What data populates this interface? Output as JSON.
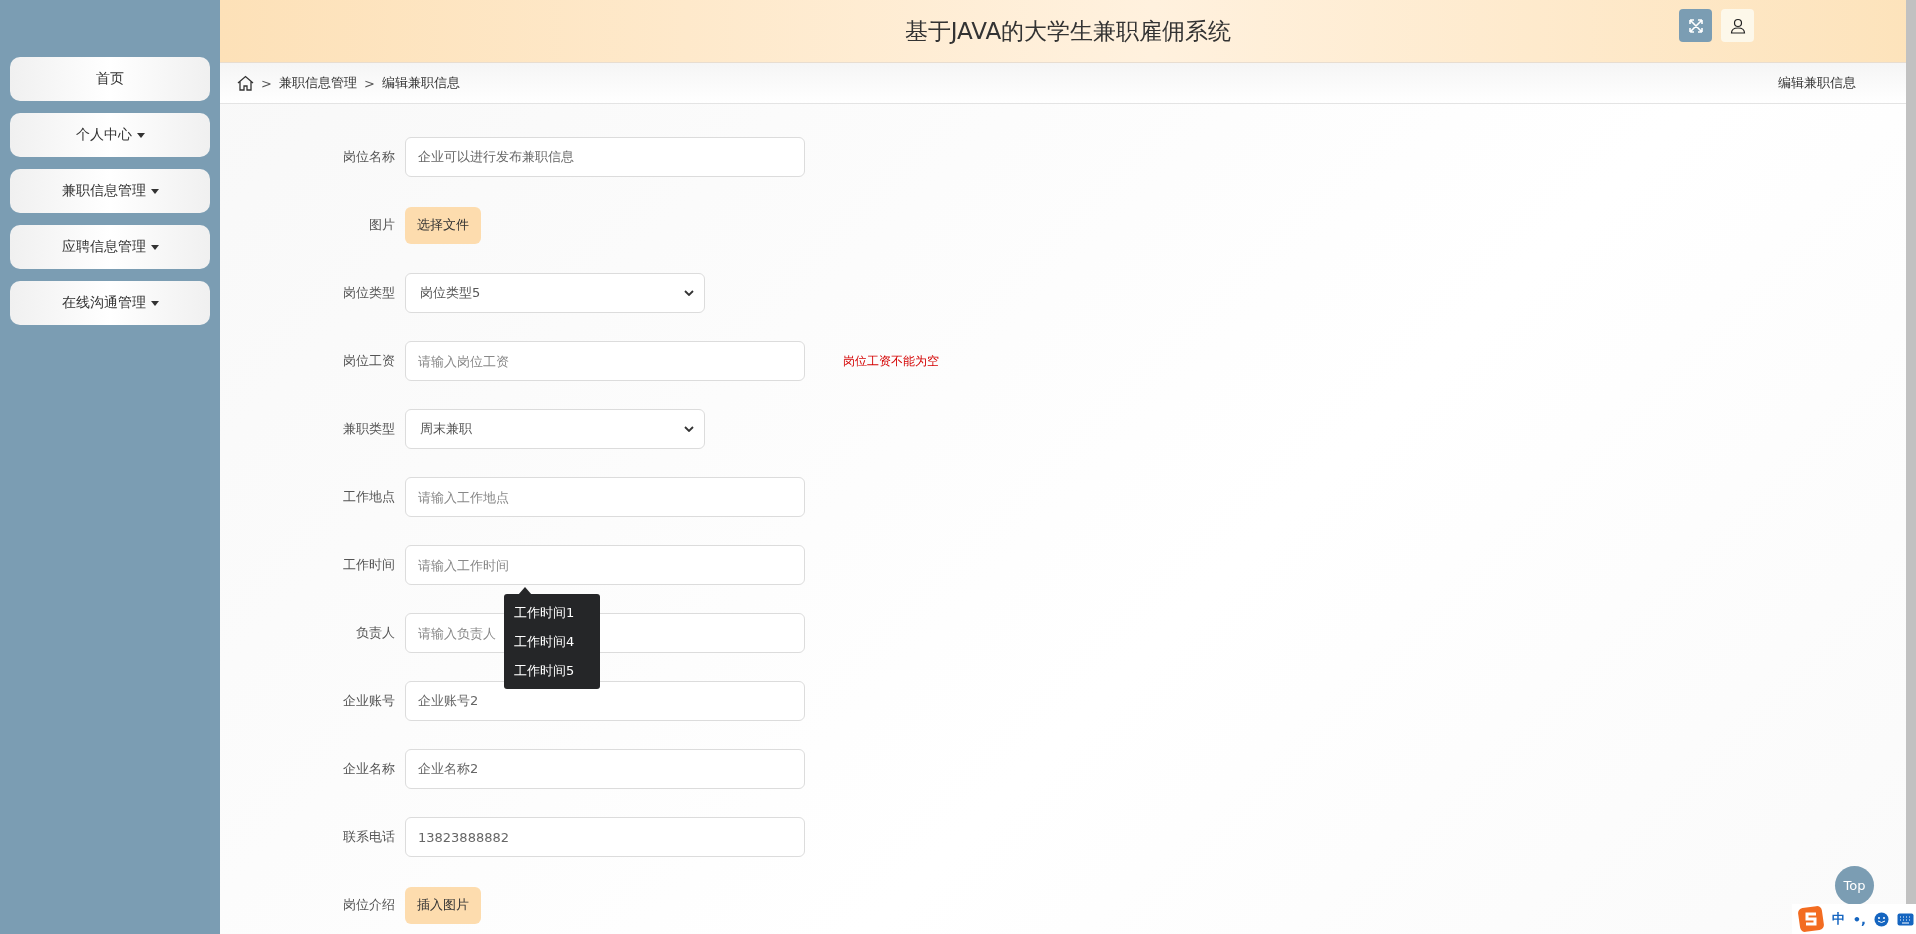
{
  "header": {
    "title": "基于JAVA的大学生兼职雇佣系统"
  },
  "sidebar": {
    "items": [
      {
        "label": "首页",
        "has_menu": false
      },
      {
        "label": "个人中心",
        "has_menu": true
      },
      {
        "label": "兼职信息管理",
        "has_menu": true
      },
      {
        "label": "应聘信息管理",
        "has_menu": true
      },
      {
        "label": "在线沟通管理",
        "has_menu": true
      }
    ]
  },
  "breadcrumb": {
    "separator": ">",
    "items": [
      "兼职信息管理",
      "编辑兼职信息"
    ],
    "page_title": "编辑兼职信息"
  },
  "form": {
    "fields": [
      {
        "label": "岗位名称",
        "kind": "text",
        "value": "企业可以进行发布兼职信息"
      },
      {
        "label": "图片",
        "kind": "file",
        "button": "选择文件"
      },
      {
        "label": "岗位类型",
        "kind": "select",
        "value": "岗位类型5"
      },
      {
        "label": "岗位工资",
        "kind": "text",
        "placeholder": "请输入岗位工资",
        "error": "岗位工资不能为空"
      },
      {
        "label": "兼职类型",
        "kind": "select",
        "value": "周末兼职"
      },
      {
        "label": "工作地点",
        "kind": "text",
        "placeholder": "请输入工作地点"
      },
      {
        "label": "工作时间",
        "kind": "text",
        "placeholder": "请输入工作时间",
        "suggestions": [
          "工作时间1",
          "工作时间4",
          "工作时间5"
        ]
      },
      {
        "label": "负责人",
        "kind": "text",
        "placeholder": "请输入负责人"
      },
      {
        "label": "企业账号",
        "kind": "text",
        "value": "企业账号2"
      },
      {
        "label": "企业名称",
        "kind": "text",
        "value": "企业名称2"
      },
      {
        "label": "联系电话",
        "kind": "text",
        "value": "13823888882"
      },
      {
        "label": "岗位介绍",
        "kind": "file",
        "button": "插入图片"
      }
    ]
  },
  "top_button": "Top",
  "ime_bar": {
    "mode": "中",
    "punctuation": "•,"
  }
}
